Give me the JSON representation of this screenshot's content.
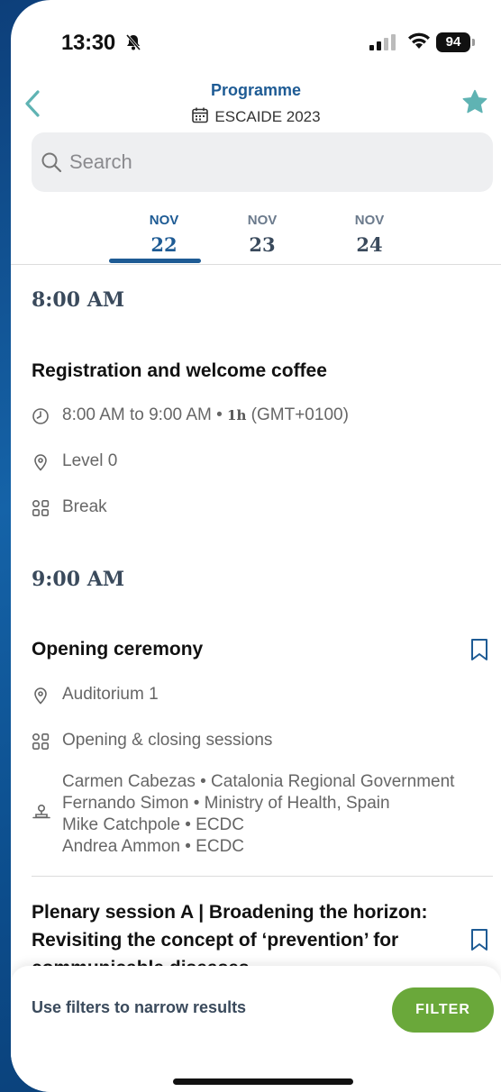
{
  "status": {
    "time": "13:30",
    "battery": "94"
  },
  "nav": {
    "title": "Programme",
    "subtitle": "ESCAIDE 2023"
  },
  "search": {
    "placeholder": "Search"
  },
  "tabs": [
    {
      "month": "NOV",
      "day": "22",
      "active": true
    },
    {
      "month": "NOV",
      "day": "23",
      "active": false
    },
    {
      "month": "NOV",
      "day": "24",
      "active": false
    }
  ],
  "blocks": {
    "b1": {
      "time": "8:00 AM",
      "title": "Registration and welcome coffee",
      "time_range": "8:00 AM to 9:00 AM",
      "separator": "•",
      "duration": "1h",
      "timezone": "(GMT+0100)",
      "location": "Level 0",
      "category": "Break"
    },
    "b2": {
      "time": "9:00 AM",
      "title": "Opening ceremony",
      "location": "Auditorium 1",
      "category": "Opening & closing sessions",
      "speakers": [
        "Carmen Cabezas • Catalonia Regional Government",
        "Fernando Simon • Ministry of Health, Spain",
        "Mike Catchpole • ECDC",
        "Andrea Ammon • ECDC"
      ]
    },
    "b3": {
      "title": "Plenary session A | Broadening the horizon: Revisiting the concept of ‘prevention’ for communicable diseases"
    }
  },
  "bottom": {
    "hint": "Use filters to narrow results",
    "filter_label": "FILTER"
  },
  "colors": {
    "primary": "#1e5b94",
    "accent": "#6aa83a",
    "star": "#5fb3b3"
  }
}
